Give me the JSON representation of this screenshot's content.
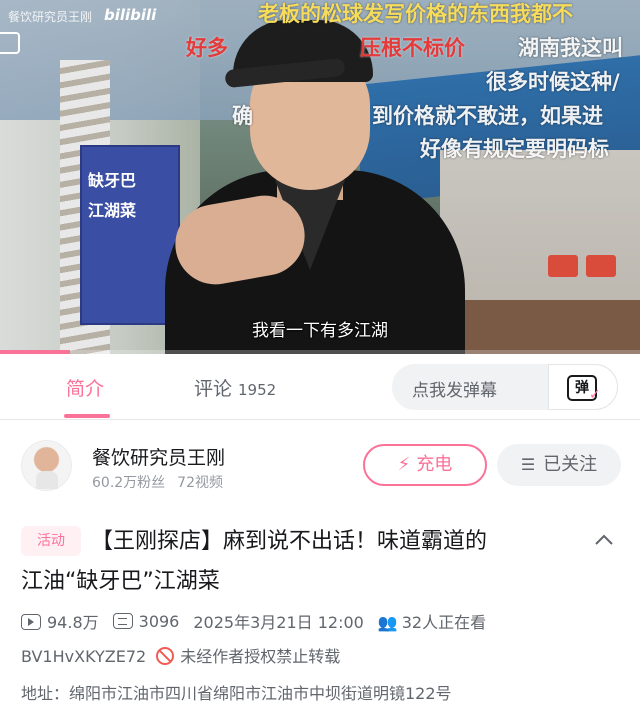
{
  "video": {
    "watermark": "餐饮研究员王刚",
    "logo": "bilibili",
    "subtitle": "我看一下有多江湖",
    "progress_fraction": 0.11,
    "shop_sign": [
      "缺牙巴",
      "江湖菜"
    ],
    "danmaku": [
      {
        "text": "老板的松球发写价格的东西我都不",
        "style": "yellow"
      },
      {
        "text": "好多",
        "style": "red"
      },
      {
        "text": "压根不标价",
        "style": "red"
      },
      {
        "text": "湖南我这叫",
        "style": "white"
      },
      {
        "text": "很多时候这种/",
        "style": "white"
      },
      {
        "text": "确",
        "style": "white"
      },
      {
        "text": "到价格就不敢进，如果进",
        "style": "white"
      },
      {
        "text": "好像有规定要明码标",
        "style": "white"
      }
    ]
  },
  "tabs": {
    "intro": "简介",
    "comments": "评论",
    "comments_count": "1952",
    "danmaku_placeholder": "点我发弹幕",
    "danmaku_toggle": "弹"
  },
  "uploader": {
    "name": "餐饮研究员王刚",
    "followers": "60.2万粉丝",
    "videos": "72视频",
    "charge_label": "充电",
    "follow_label": "已关注"
  },
  "video_info": {
    "tag": "活动",
    "title_line1": "【王刚探店】麻到说不出话！味道霸道的",
    "title_line2": "江油“缺牙巴”江湖菜",
    "views": "94.8万",
    "danmaku_count": "3096",
    "publish_time": "2025年3月21日 12:00",
    "watching": "32人正在看",
    "bvid": "BV1HvXKYZE72",
    "repost_notice": "未经作者授权禁止转载",
    "address": "地址：绵阳市江油市四川省绵阳市江油市中坝街道明镜122号"
  },
  "colors": {
    "accent": "#fb7299",
    "text_primary": "#18191c",
    "text_secondary": "#61666d",
    "ban_red": "#f05c54"
  }
}
